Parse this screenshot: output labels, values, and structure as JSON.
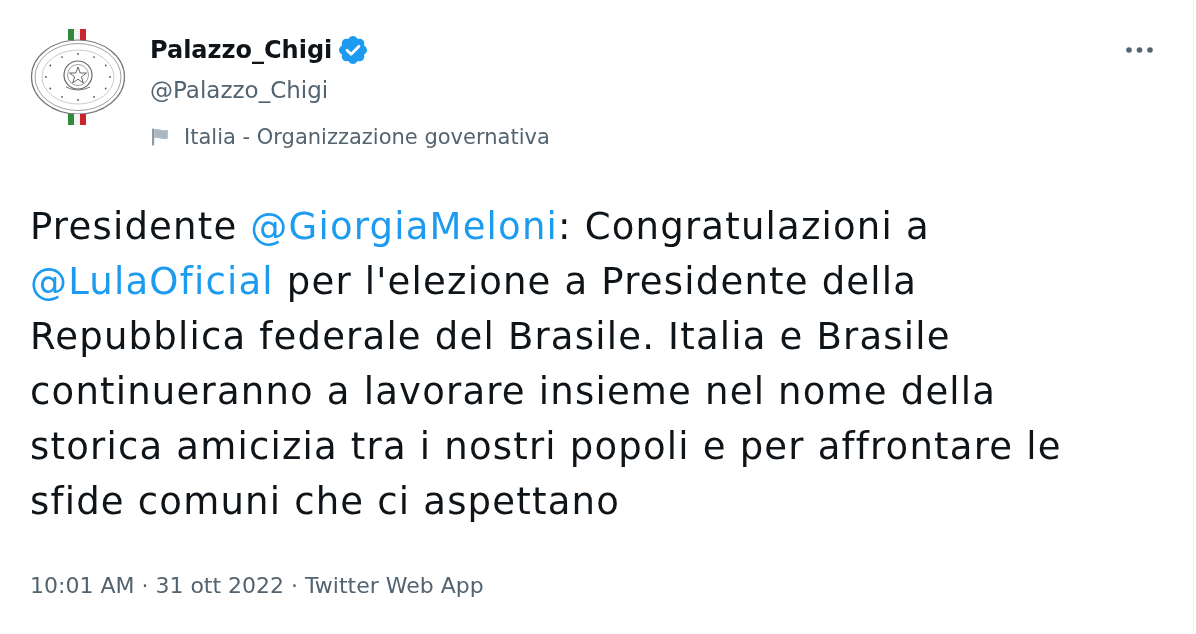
{
  "author": {
    "name": "Palazzo_Chigi",
    "verified": true,
    "handle": "@Palazzo_Chigi",
    "category": "Italia - Organizzazione governativa"
  },
  "tweet": {
    "segments": [
      {
        "kind": "text",
        "text": "Presidente "
      },
      {
        "kind": "mention",
        "text": "@GiorgiaMeloni"
      },
      {
        "kind": "text",
        "text": ": Congratulazioni a "
      },
      {
        "kind": "mention",
        "text": "@LulaOficial"
      },
      {
        "kind": "text",
        "text": " per l'elezione a Presidente della Repubblica federale del Brasile. Italia e Brasile continueranno a lavorare insieme nel nome della storica amicizia tra i nostri popoli e per affrontare le sfide comuni che ci aspettano"
      }
    ]
  },
  "meta": "10:01 AM · 31 ott 2022 · Twitter Web App"
}
